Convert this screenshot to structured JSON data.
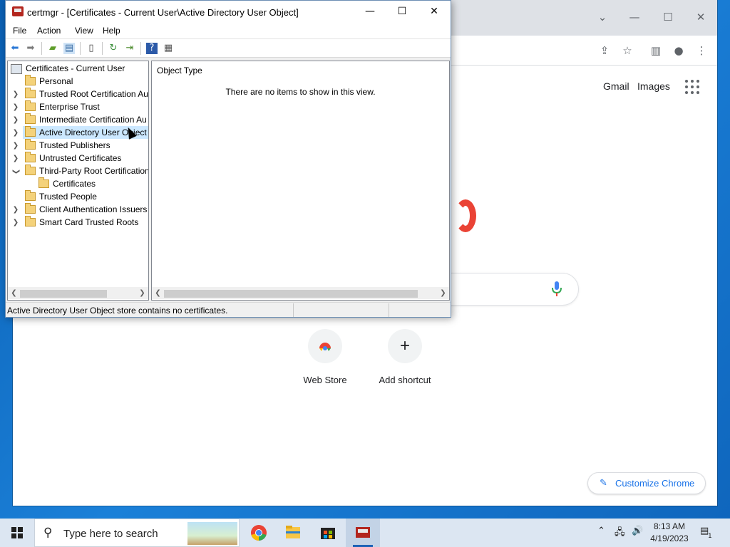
{
  "certmgr": {
    "title": "certmgr - [Certificates - Current User\\Active Directory User Object]",
    "menu": [
      "File",
      "Action",
      "View",
      "Help"
    ],
    "tree": {
      "root": "Certificates - Current User",
      "items": [
        {
          "label": "Personal"
        },
        {
          "label": "Trusted Root Certification Au"
        },
        {
          "label": "Enterprise Trust"
        },
        {
          "label": "Intermediate Certification Au"
        },
        {
          "label": "Active Directory User Object",
          "selected": true
        },
        {
          "label": "Trusted Publishers"
        },
        {
          "label": "Untrusted Certificates"
        },
        {
          "label": "Third-Party Root Certification",
          "expanded": true
        },
        {
          "label": "Certificates",
          "child": true
        },
        {
          "label": "Trusted People"
        },
        {
          "label": "Client Authentication Issuers"
        },
        {
          "label": "Smart Card Trusted Roots"
        }
      ]
    },
    "list": {
      "column": "Object Type",
      "empty_message": "There are no items to show in this view."
    },
    "status": "Active Directory User Object store contains no certificates."
  },
  "chrome": {
    "links": [
      "Gmail",
      "Images"
    ],
    "shortcuts": [
      {
        "label": "Web Store",
        "icon": "chrome-webstore-icon"
      },
      {
        "label": "Add shortcut",
        "icon": "+"
      }
    ],
    "customize": "Customize Chrome"
  },
  "taskbar": {
    "search_placeholder": "Type here to search",
    "time": "8:13 AM",
    "date": "4/19/2023",
    "notification_count": "1"
  }
}
